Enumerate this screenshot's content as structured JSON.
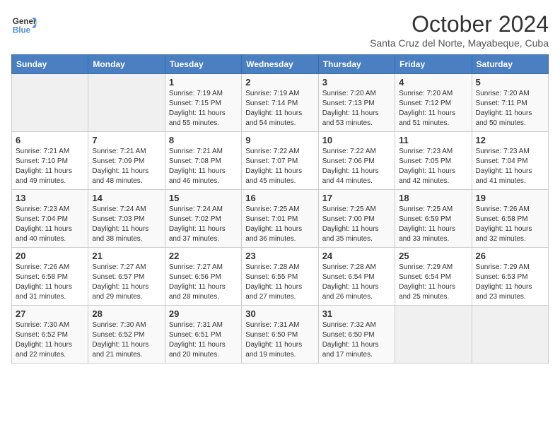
{
  "header": {
    "logo_line1": "General",
    "logo_line2": "Blue",
    "month_title": "October 2024",
    "subtitle": "Santa Cruz del Norte, Mayabeque, Cuba"
  },
  "days_of_week": [
    "Sunday",
    "Monday",
    "Tuesday",
    "Wednesday",
    "Thursday",
    "Friday",
    "Saturday"
  ],
  "weeks": [
    [
      {
        "day": "",
        "info": ""
      },
      {
        "day": "",
        "info": ""
      },
      {
        "day": "1",
        "info": "Sunrise: 7:19 AM\nSunset: 7:15 PM\nDaylight: 11 hours and 55 minutes."
      },
      {
        "day": "2",
        "info": "Sunrise: 7:19 AM\nSunset: 7:14 PM\nDaylight: 11 hours and 54 minutes."
      },
      {
        "day": "3",
        "info": "Sunrise: 7:20 AM\nSunset: 7:13 PM\nDaylight: 11 hours and 53 minutes."
      },
      {
        "day": "4",
        "info": "Sunrise: 7:20 AM\nSunset: 7:12 PM\nDaylight: 11 hours and 51 minutes."
      },
      {
        "day": "5",
        "info": "Sunrise: 7:20 AM\nSunset: 7:11 PM\nDaylight: 11 hours and 50 minutes."
      }
    ],
    [
      {
        "day": "6",
        "info": "Sunrise: 7:21 AM\nSunset: 7:10 PM\nDaylight: 11 hours and 49 minutes."
      },
      {
        "day": "7",
        "info": "Sunrise: 7:21 AM\nSunset: 7:09 PM\nDaylight: 11 hours and 48 minutes."
      },
      {
        "day": "8",
        "info": "Sunrise: 7:21 AM\nSunset: 7:08 PM\nDaylight: 11 hours and 46 minutes."
      },
      {
        "day": "9",
        "info": "Sunrise: 7:22 AM\nSunset: 7:07 PM\nDaylight: 11 hours and 45 minutes."
      },
      {
        "day": "10",
        "info": "Sunrise: 7:22 AM\nSunset: 7:06 PM\nDaylight: 11 hours and 44 minutes."
      },
      {
        "day": "11",
        "info": "Sunrise: 7:23 AM\nSunset: 7:05 PM\nDaylight: 11 hours and 42 minutes."
      },
      {
        "day": "12",
        "info": "Sunrise: 7:23 AM\nSunset: 7:04 PM\nDaylight: 11 hours and 41 minutes."
      }
    ],
    [
      {
        "day": "13",
        "info": "Sunrise: 7:23 AM\nSunset: 7:04 PM\nDaylight: 11 hours and 40 minutes."
      },
      {
        "day": "14",
        "info": "Sunrise: 7:24 AM\nSunset: 7:03 PM\nDaylight: 11 hours and 38 minutes."
      },
      {
        "day": "15",
        "info": "Sunrise: 7:24 AM\nSunset: 7:02 PM\nDaylight: 11 hours and 37 minutes."
      },
      {
        "day": "16",
        "info": "Sunrise: 7:25 AM\nSunset: 7:01 PM\nDaylight: 11 hours and 36 minutes."
      },
      {
        "day": "17",
        "info": "Sunrise: 7:25 AM\nSunset: 7:00 PM\nDaylight: 11 hours and 35 minutes."
      },
      {
        "day": "18",
        "info": "Sunrise: 7:25 AM\nSunset: 6:59 PM\nDaylight: 11 hours and 33 minutes."
      },
      {
        "day": "19",
        "info": "Sunrise: 7:26 AM\nSunset: 6:58 PM\nDaylight: 11 hours and 32 minutes."
      }
    ],
    [
      {
        "day": "20",
        "info": "Sunrise: 7:26 AM\nSunset: 6:58 PM\nDaylight: 11 hours and 31 minutes."
      },
      {
        "day": "21",
        "info": "Sunrise: 7:27 AM\nSunset: 6:57 PM\nDaylight: 11 hours and 29 minutes."
      },
      {
        "day": "22",
        "info": "Sunrise: 7:27 AM\nSunset: 6:56 PM\nDaylight: 11 hours and 28 minutes."
      },
      {
        "day": "23",
        "info": "Sunrise: 7:28 AM\nSunset: 6:55 PM\nDaylight: 11 hours and 27 minutes."
      },
      {
        "day": "24",
        "info": "Sunrise: 7:28 AM\nSunset: 6:54 PM\nDaylight: 11 hours and 26 minutes."
      },
      {
        "day": "25",
        "info": "Sunrise: 7:29 AM\nSunset: 6:54 PM\nDaylight: 11 hours and 25 minutes."
      },
      {
        "day": "26",
        "info": "Sunrise: 7:29 AM\nSunset: 6:53 PM\nDaylight: 11 hours and 23 minutes."
      }
    ],
    [
      {
        "day": "27",
        "info": "Sunrise: 7:30 AM\nSunset: 6:52 PM\nDaylight: 11 hours and 22 minutes."
      },
      {
        "day": "28",
        "info": "Sunrise: 7:30 AM\nSunset: 6:52 PM\nDaylight: 11 hours and 21 minutes."
      },
      {
        "day": "29",
        "info": "Sunrise: 7:31 AM\nSunset: 6:51 PM\nDaylight: 11 hours and 20 minutes."
      },
      {
        "day": "30",
        "info": "Sunrise: 7:31 AM\nSunset: 6:50 PM\nDaylight: 11 hours and 19 minutes."
      },
      {
        "day": "31",
        "info": "Sunrise: 7:32 AM\nSunset: 6:50 PM\nDaylight: 11 hours and 17 minutes."
      },
      {
        "day": "",
        "info": ""
      },
      {
        "day": "",
        "info": ""
      }
    ]
  ]
}
